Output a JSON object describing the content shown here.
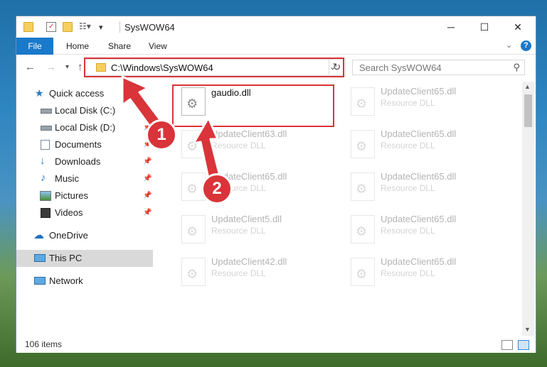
{
  "window": {
    "title": "SysWOW64",
    "controls": {
      "minimize": "─",
      "maximize": "☐",
      "close": "✕"
    }
  },
  "ribbon": {
    "tabs": [
      "File",
      "Home",
      "Share",
      "View"
    ]
  },
  "navigation": {
    "address": "C:\\Windows\\SysWOW64",
    "search_placeholder": "Search SysWOW64"
  },
  "sidebar": {
    "items": [
      {
        "label": "Quick access",
        "icon": "star-icon",
        "pinned": false
      },
      {
        "label": "Local Disk (C:)",
        "icon": "drive-icon",
        "pinned": true
      },
      {
        "label": "Local Disk (D:)",
        "icon": "drive-icon",
        "pinned": true
      },
      {
        "label": "Documents",
        "icon": "documents-icon",
        "pinned": true
      },
      {
        "label": "Downloads",
        "icon": "downloads-icon",
        "pinned": true
      },
      {
        "label": "Music",
        "icon": "music-icon",
        "pinned": true
      },
      {
        "label": "Pictures",
        "icon": "pictures-icon",
        "pinned": true
      },
      {
        "label": "Videos",
        "icon": "videos-icon",
        "pinned": true
      },
      {
        "label": "OneDrive",
        "icon": "cloud-icon",
        "pinned": false
      },
      {
        "label": "This PC",
        "icon": "computer-icon",
        "pinned": false,
        "selected": true
      },
      {
        "label": "Network",
        "icon": "network-icon",
        "pinned": false
      }
    ]
  },
  "files": {
    "column_left": [
      {
        "name": "gaudio.dll",
        "type": ""
      },
      {
        "name": "UpdateClient63.dll",
        "type": "Resource DLL"
      },
      {
        "name": "UpdateClient65.dll",
        "type": "Resource DLL"
      },
      {
        "name": "UpdateClient5.dll",
        "type": "Resource DLL"
      },
      {
        "name": "UpdateClient42.dll",
        "type": "Resource DLL"
      }
    ],
    "column_right": [
      {
        "name": "UpdateClient65.dll",
        "type": "Resource DLL"
      },
      {
        "name": "UpdateClient65.dll",
        "type": "Resource DLL"
      },
      {
        "name": "UpdateClient65.dll",
        "type": "Resource DLL"
      },
      {
        "name": "UpdateClient65.dll",
        "type": "Resource DLL"
      },
      {
        "name": "UpdateClient65.dll",
        "type": "Resource DLL"
      }
    ]
  },
  "status": {
    "item_count": "106 items"
  },
  "annotations": {
    "step1": "1",
    "step2": "2",
    "accent": "#d9343a"
  }
}
